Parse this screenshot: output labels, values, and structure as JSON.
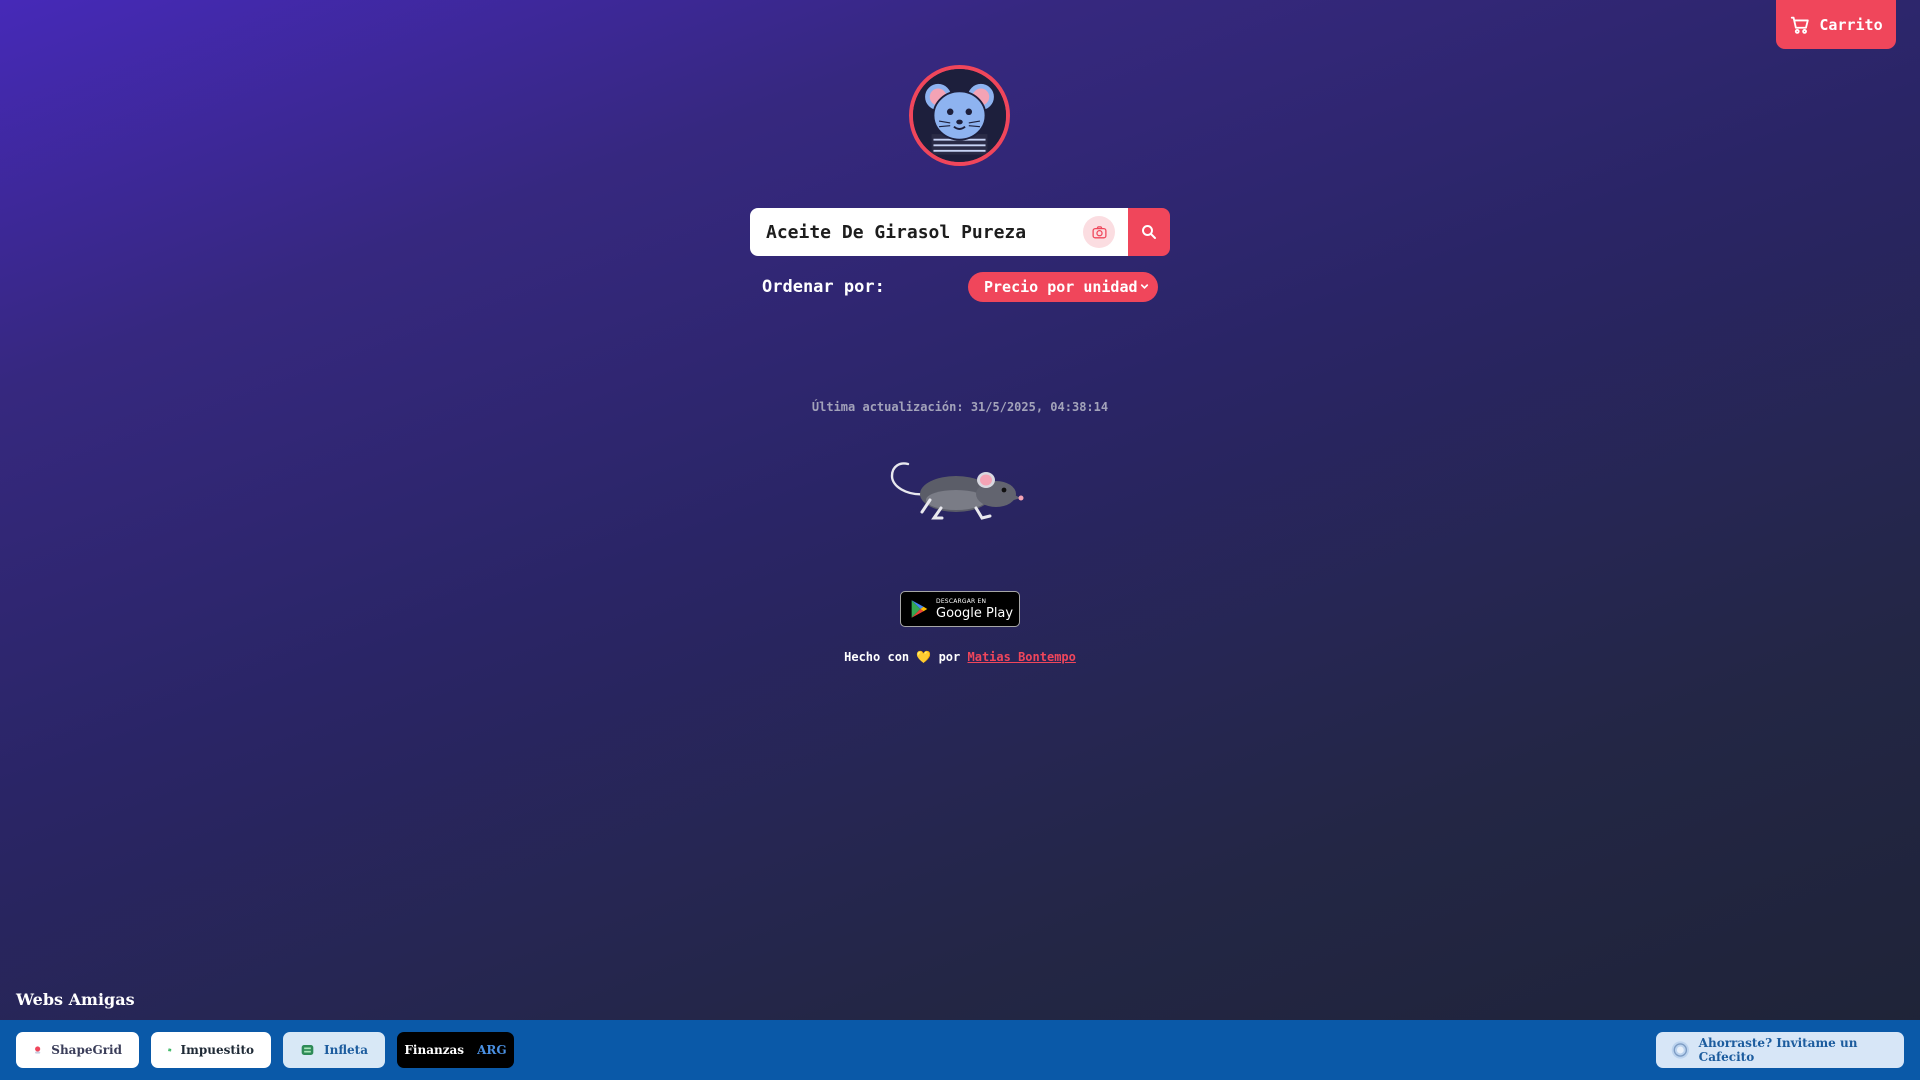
{
  "header": {
    "cart_label": "Carrito",
    "cart_icon": "cart-icon"
  },
  "logo": {
    "icon": "mouse-logo"
  },
  "search": {
    "value": "Aceite De Girasol Pureza",
    "camera_icon": "camera-icon",
    "search_icon": "search-icon"
  },
  "sort": {
    "label": "Ordenar por:",
    "selected": "Precio por unidad"
  },
  "update": {
    "text": "Última actualización: 31/5/2025, 04:38:14"
  },
  "google_play": {
    "small": "DESCARGAR EN",
    "big": "Google Play"
  },
  "credits": {
    "made_with": "Hecho con",
    "heart": "💛",
    "by": "por",
    "author": "Matias Bontempo"
  },
  "friends": {
    "title": "Webs Amigas",
    "items": [
      {
        "label": "ShapeGrid"
      },
      {
        "label": "Impuestito"
      },
      {
        "label": "Infleta"
      },
      {
        "label": "Finanzas",
        "suffix": "ARG"
      }
    ]
  },
  "coffee": {
    "label": "Ahorraste? Invitame un Cafecito"
  },
  "colors": {
    "accent": "#f0465b",
    "footer": "#0a59a8",
    "bg_top": "#4629b8",
    "bg_bottom": "#1e2336"
  }
}
